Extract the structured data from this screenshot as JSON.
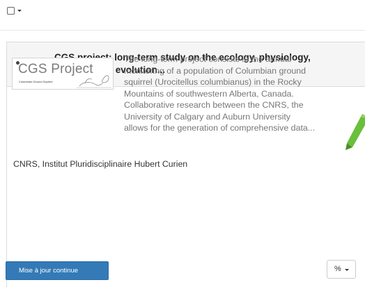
{
  "toolbar": {
    "select_all_icon": "checkbox-icon",
    "dropdown_icon": "caret-down-icon"
  },
  "card": {
    "title_line1": "CGS project: long-term study on the ecology, physiology,",
    "title_line2": "behavior and evolution...",
    "type_icon": "database-icon",
    "logo": {
      "name": "CGS Project",
      "subtitle": "Columbian Ground Squirrel"
    },
    "description_lines": [
      "The long-term project consists in the annual",
      "monitoring of a population of Columbian ground",
      "squirrel (Urocitellus columbianus) in the Rocky",
      "Mountains of southwestern Alberta, Canada.",
      "Collaborative research between the CNRS, the",
      "University of Calgary and Auburn University",
      "allows for the generation of comprehensive data..."
    ],
    "institution": "CNRS, Institut Pluridisciplinaire Hubert Curien",
    "status_button": "Mise à jour continue",
    "link_button_icon": "link-icon",
    "edit_icon": "pencil-icon"
  },
  "colors": {
    "primary_button": "#337ab7",
    "header_bg": "#f5f5f5",
    "pencil_green": "#6abf3c"
  }
}
